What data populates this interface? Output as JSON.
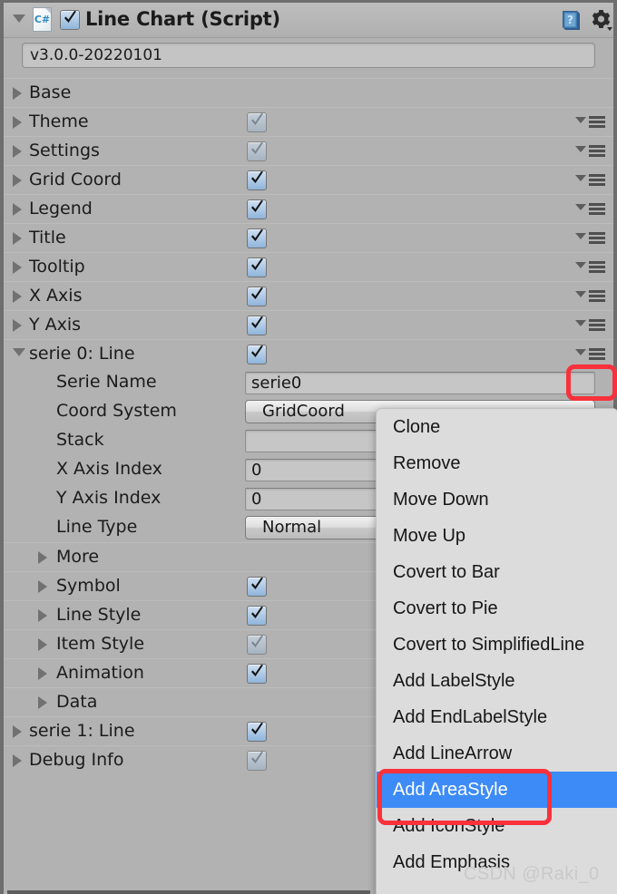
{
  "component": {
    "title": "Line Chart (Script)",
    "script_icon": "csharp-script-icon",
    "script_icon_text": "C#",
    "enabled": true,
    "foldout_expanded": true,
    "help_icon": "help-book-icon",
    "settings_icon": "gear-icon",
    "version": "v3.0.0-20220101"
  },
  "rows": [
    {
      "label": "Base",
      "level": 0,
      "expanded": false,
      "checkbox": null,
      "menu": false
    },
    {
      "label": "Theme",
      "level": 0,
      "expanded": false,
      "checkbox": "dim",
      "menu": true
    },
    {
      "label": "Settings",
      "level": 0,
      "expanded": false,
      "checkbox": "dim",
      "menu": true
    },
    {
      "label": "Grid Coord",
      "level": 0,
      "expanded": false,
      "checkbox": "on",
      "menu": true
    },
    {
      "label": "Legend",
      "level": 0,
      "expanded": false,
      "checkbox": "on",
      "menu": true
    },
    {
      "label": "Title",
      "level": 0,
      "expanded": false,
      "checkbox": "on",
      "menu": true
    },
    {
      "label": "Tooltip",
      "level": 0,
      "expanded": false,
      "checkbox": "on",
      "menu": true
    },
    {
      "label": "X Axis",
      "level": 0,
      "expanded": false,
      "checkbox": "on",
      "menu": true
    },
    {
      "label": "Y Axis",
      "level": 0,
      "expanded": false,
      "checkbox": "on",
      "menu": true
    },
    {
      "label": "serie 0: Line",
      "level": 0,
      "expanded": true,
      "checkbox": "on",
      "menu": true
    }
  ],
  "serie_fields": [
    {
      "label": "Serie Name",
      "value": "serie0",
      "type": "text"
    },
    {
      "label": "Coord System",
      "value": "GridCoord",
      "type": "popup"
    },
    {
      "label": "Stack",
      "value": "",
      "type": "text"
    },
    {
      "label": "X Axis Index",
      "value": "0",
      "type": "text"
    },
    {
      "label": "Y Axis Index",
      "value": "0",
      "type": "text"
    },
    {
      "label": "Line Type",
      "value": "Normal",
      "type": "popup"
    }
  ],
  "serie_subrows": [
    {
      "label": "More",
      "level": 1,
      "expanded": false,
      "checkbox": null,
      "menu": false
    },
    {
      "label": "Symbol",
      "level": 1,
      "expanded": false,
      "checkbox": "on",
      "menu": false
    },
    {
      "label": "Line Style",
      "level": 1,
      "expanded": false,
      "checkbox": "on",
      "menu": false
    },
    {
      "label": "Item Style",
      "level": 1,
      "expanded": false,
      "checkbox": "dim",
      "menu": false
    },
    {
      "label": "Animation",
      "level": 1,
      "expanded": false,
      "checkbox": "on",
      "menu": false
    },
    {
      "label": "Data",
      "level": 1,
      "expanded": false,
      "checkbox": null,
      "menu": false
    }
  ],
  "tail_rows": [
    {
      "label": "serie 1: Line",
      "level": 0,
      "expanded": false,
      "checkbox": "on",
      "menu": false
    },
    {
      "label": "Debug Info",
      "level": 0,
      "expanded": false,
      "checkbox": "dim",
      "menu": false
    }
  ],
  "context_menu": {
    "items": [
      {
        "label": "Clone",
        "selected": false
      },
      {
        "label": "Remove",
        "selected": false
      },
      {
        "label": "Move Down",
        "selected": false
      },
      {
        "label": "Move Up",
        "selected": false
      },
      {
        "label": "Covert to Bar",
        "selected": false
      },
      {
        "label": "Covert to Pie",
        "selected": false
      },
      {
        "label": "Covert to SimplifiedLine",
        "selected": false
      },
      {
        "label": "Add LabelStyle",
        "selected": false
      },
      {
        "label": "Add EndLabelStyle",
        "selected": false
      },
      {
        "label": "Add LineArrow",
        "selected": false
      },
      {
        "label": "Add AreaStyle",
        "selected": true
      },
      {
        "label": "Add IconStyle",
        "selected": false
      },
      {
        "label": "Add Emphasis",
        "selected": false
      }
    ],
    "highlight_color": "#3d8bf7"
  },
  "annotations": {
    "box_color": "#f9313b",
    "boxes": [
      "serie-0-menu-button",
      "add-areastyle-menu-item"
    ]
  },
  "watermark": "CSDN @Raki_0"
}
